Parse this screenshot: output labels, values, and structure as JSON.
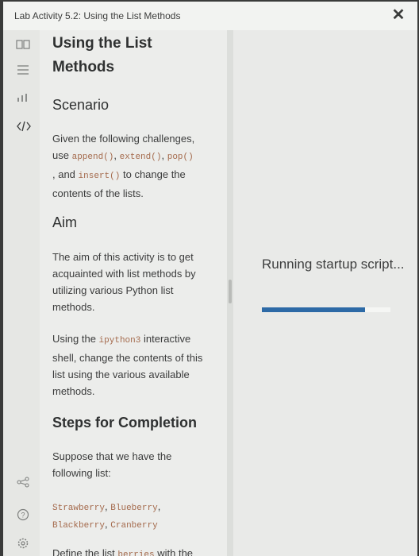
{
  "window": {
    "title": "Lab Activity 5.2: Using the List Methods",
    "close_label": "✕"
  },
  "rail": {
    "icons": [
      "book-icon",
      "list-icon",
      "chart-icon",
      "code-icon",
      "share-icon",
      "help-icon",
      "settings-icon"
    ]
  },
  "content": {
    "heading_line1": "Using the List",
    "heading_line2": "Methods",
    "scenario_title": "Scenario",
    "scenario_text_1": "Given the following challenges,",
    "scenario_text_2": "use",
    "code_append": "append()",
    "sep_comma": ",",
    "code_extend": "extend()",
    "code_pop": "pop()",
    "scenario_text_3": ", and",
    "code_insert": "insert()",
    "scenario_text_4": "to change the",
    "scenario_text_5": "contents of the lists.",
    "aim_title": "Aim",
    "aim_text": "The aim of this activity is to get acquainted with list methods by utilizing various Python list methods.",
    "using_text_1": "Using the",
    "code_ipython": "ipython3",
    "using_text_2": "interactive shell, change the contents of this list using the various available methods.",
    "steps_title": "Steps for Completion",
    "steps_text": "Suppose that we have the following list:",
    "list_item1": "Strawberry",
    "list_item2": "Blueberry",
    "list_item3": "Blackberry",
    "list_item4": "Cranberry",
    "define_text": "Define the list",
    "code_berries": "berries",
    "define_text_2": "with the"
  },
  "status": {
    "running_text": "Running startup script...",
    "progress": 0.8
  },
  "colors": {
    "accent": "#2d6aa6",
    "code": "#a46a4c"
  }
}
